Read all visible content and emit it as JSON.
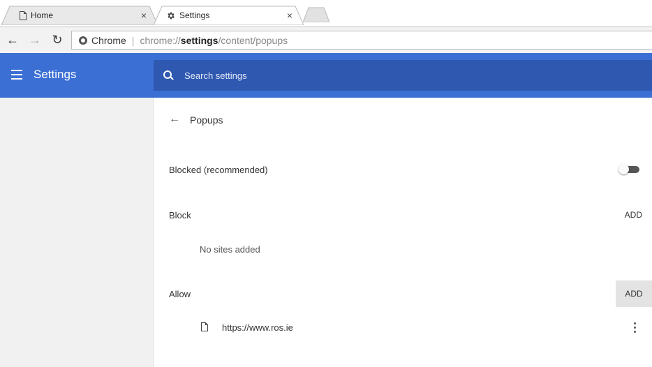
{
  "tabs": [
    {
      "title": "Home",
      "icon": "page-icon"
    },
    {
      "title": "Settings",
      "icon": "gear-icon"
    }
  ],
  "tab_close_glyph": "×",
  "omnibox": {
    "chip_label": "Chrome",
    "url_scheme": "chrome://",
    "url_host": "settings",
    "url_path": "/content/popups"
  },
  "header": {
    "title": "Settings",
    "search_placeholder": "Search settings",
    "accent": "#3b6fd4"
  },
  "page": {
    "title": "Popups",
    "blocked_label": "Blocked (recommended)",
    "blocked_enabled": false,
    "block_section": {
      "label": "Block",
      "add_label": "ADD",
      "empty_text": "No sites added"
    },
    "allow_section": {
      "label": "Allow",
      "add_label": "ADD",
      "sites": [
        "https://www.ros.ie"
      ]
    }
  }
}
